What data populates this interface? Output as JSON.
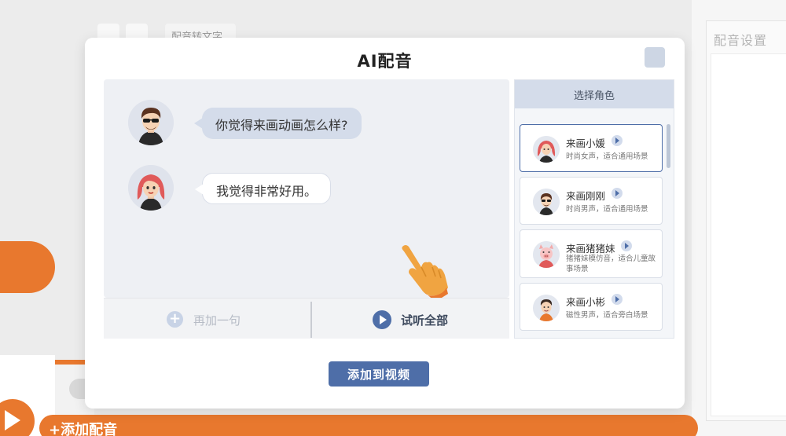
{
  "background": {
    "tab_label": "配音转文字",
    "settings_title": "配音设置",
    "add_voice_label": "+添加配音"
  },
  "dialog": {
    "title": "AI配音",
    "messages": [
      {
        "text": "你觉得来画动画怎么样?",
        "style": "blue",
        "avatar": "male-avatar"
      },
      {
        "text": "我觉得非常好用。",
        "style": "white",
        "avatar": "female-avatar"
      }
    ],
    "add_sentence_label": "再加一句",
    "listen_all_label": "试听全部",
    "add_to_video_label": "添加到视频",
    "roles": {
      "header": "选择角色",
      "items": [
        {
          "name": "来画小媛",
          "desc": "时尚女声，适合通用场景",
          "selected": true
        },
        {
          "name": "来画刚刚",
          "desc": "时尚男声，适合通用场景",
          "selected": false
        },
        {
          "name": "来画猪猪妹",
          "desc": "猪猪妹模仿音，适合儿童故事场景",
          "selected": false
        },
        {
          "name": "来画小彬",
          "desc": "磁性男声，适合旁白场景",
          "selected": false
        }
      ]
    }
  },
  "colors": {
    "accent": "#4e6ea8",
    "orange": "#e8782e",
    "bubble_blue": "#d4dcea"
  }
}
